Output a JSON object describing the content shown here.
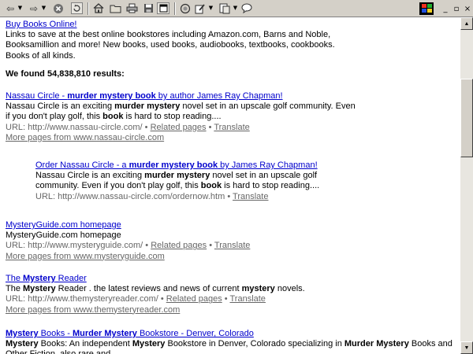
{
  "colors": {
    "link": "#0000cc",
    "chrome": "#d4d0c8",
    "url_text": "#666666"
  },
  "toolbar": {
    "icons": [
      "back-arrow-icon",
      "forward-arrow-icon",
      "stop-icon",
      "refresh-icon",
      "home-icon",
      "folder-icon",
      "print-icon",
      "floppy-disk-icon",
      "fullscreen-icon",
      "search-icon",
      "edit-icon",
      "history-icon",
      "discuss-icon"
    ],
    "window_controls": {
      "minimize": "_",
      "restore": "▫",
      "close": "×"
    }
  },
  "sponsored": {
    "title": "Buy Books Online!",
    "lines": [
      "Links to save at the best online bookstores including Amazon.com, Barns and Noble,",
      "Booksamillion and more! New books, used books, audiobooks, textbooks, cookbooks.",
      "Books of all kinds."
    ]
  },
  "results_count": "We found 54,838,810 results:",
  "url_prefix": "URL: ",
  "results": [
    {
      "title": [
        {
          "t": "Nassau Circle - "
        },
        {
          "t": "murder mystery book",
          "b": true
        },
        {
          "t": " by author James Ray Chapman!"
        }
      ],
      "snippet": [
        [
          {
            "t": "Nassau Circle is an exciting "
          },
          {
            "t": "murder mystery",
            "b": true
          },
          {
            "t": " novel set in an upscale golf community. Even"
          }
        ],
        [
          {
            "t": "if you don't play golf, this "
          },
          {
            "t": "book",
            "b": true
          },
          {
            "t": " is hard to stop reading...."
          }
        ]
      ],
      "url": "http://www.nassau-circle.com/",
      "related": "Related pages",
      "translate": "Translate",
      "more": "More pages from www.nassau-circle.com"
    },
    {
      "title": [
        {
          "t": "Order Nassau Circle - a "
        },
        {
          "t": "murder mystery book",
          "b": true
        },
        {
          "t": " by James Ray Chapman!"
        }
      ],
      "snippet": [
        [
          {
            "t": "Nassau Circle is an exciting "
          },
          {
            "t": "murder mystery",
            "b": true
          },
          {
            "t": " novel set in an upscale golf"
          }
        ],
        [
          {
            "t": "community. Even if you don't play golf, this "
          },
          {
            "t": "book",
            "b": true
          },
          {
            "t": " is hard to stop reading...."
          }
        ]
      ],
      "url": "http://www.nassau-circle.com/ordernow.htm",
      "translate": "Translate"
    },
    {
      "title": [
        {
          "t": "MysteryGuide.com homepage"
        }
      ],
      "snippet": [
        [
          {
            "t": "MysteryGuide.com homepage"
          }
        ]
      ],
      "url": "http://www.mysteryguide.com/",
      "related": "Related pages",
      "translate": "Translate",
      "more": "More pages from www.mysteryguide.com"
    },
    {
      "title": [
        {
          "t": "The "
        },
        {
          "t": "Mystery",
          "b": true
        },
        {
          "t": " Reader"
        }
      ],
      "snippet": [
        [
          {
            "t": "The "
          },
          {
            "t": "Mystery",
            "b": true
          },
          {
            "t": " Reader . the latest reviews and news of current "
          },
          {
            "t": "mystery",
            "b": true
          },
          {
            "t": " novels."
          }
        ]
      ],
      "url": "http://www.themysteryreader.com/",
      "related": "Related pages",
      "translate": "Translate",
      "more": "More pages from www.themysteryreader.com"
    },
    {
      "title": [
        {
          "t": "Mystery",
          "b": true
        },
        {
          "t": " Books - "
        },
        {
          "t": "Murder Mystery",
          "b": true
        },
        {
          "t": " Bookstore - Denver, Colorado"
        }
      ],
      "snippet": [
        [
          {
            "t": "Mystery",
            "b": true
          },
          {
            "t": " Books: An independent "
          },
          {
            "t": "Mystery",
            "b": true
          },
          {
            "t": " Bookstore in Denver, Colorado specializing in "
          },
          {
            "t": "Murder Mystery",
            "b": true
          },
          {
            "t": " Books and"
          }
        ],
        [
          {
            "t": "Other Fiction, also rare and ..."
          }
        ]
      ]
    }
  ]
}
